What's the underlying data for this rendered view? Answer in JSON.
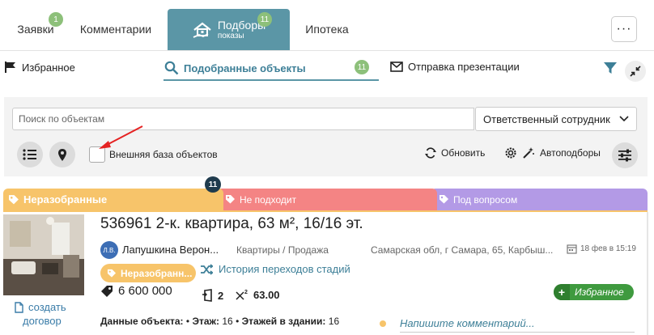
{
  "tabs": [
    {
      "label": "Заявки",
      "badge": "1"
    },
    {
      "label": "Комментарии"
    },
    {
      "label": "Подборы",
      "sublabel": "показы",
      "badge": "11",
      "active": true
    },
    {
      "label": "Ипотека"
    }
  ],
  "more_label": "···",
  "subnav": {
    "favorites": "Избранное",
    "matched": "Подобранные объекты",
    "matched_badge": "11",
    "presentation": "Отправка презентации"
  },
  "filters": {
    "search_placeholder": "Поиск по объектам",
    "employee_select": "Ответственный сотрудник",
    "external_base_label": "Внешняя база объектов",
    "external_base_checked": false,
    "refresh_label": "Обновить",
    "autopick_label": "Автоподборы"
  },
  "stages": {
    "count_badge": "11",
    "items": [
      {
        "label": "Неразобранные",
        "color": "#f7c46a"
      },
      {
        "label": "Не подходит",
        "color": "#f48484"
      },
      {
        "label": "Под вопросом",
        "color": "#b39ae6"
      }
    ]
  },
  "card": {
    "title": "536961 2-к. квартира, 63 м², 16/16 эт.",
    "agent_initials": "Л.В.",
    "agent_name": "Лапушкина Верон...",
    "type": "Квартиры / Продажа",
    "address": "Самарская обл, г Самара, 65, Карбыш...",
    "date": "18 фев в 15:19",
    "stage_pill": "Неразобранн...",
    "history_link": "История переходов стадий",
    "price": "6 600 000",
    "rooms": "2",
    "area": "63.00",
    "favorite_button": "Избранное",
    "create_contract_line1": "создать",
    "create_contract_line2": "договор",
    "details_label": "Данные объекта:",
    "floor_label": "Этаж:",
    "floor_value": "16",
    "floors_total_label": "Этажей в здании:",
    "floors_total_value": "16",
    "comment_placeholder": "Напишите комментарий..."
  },
  "colors": {
    "accent": "#5b96a6",
    "badge": "#8dc07a",
    "link": "#3d7f97",
    "favorite": "#3f9a3f"
  }
}
